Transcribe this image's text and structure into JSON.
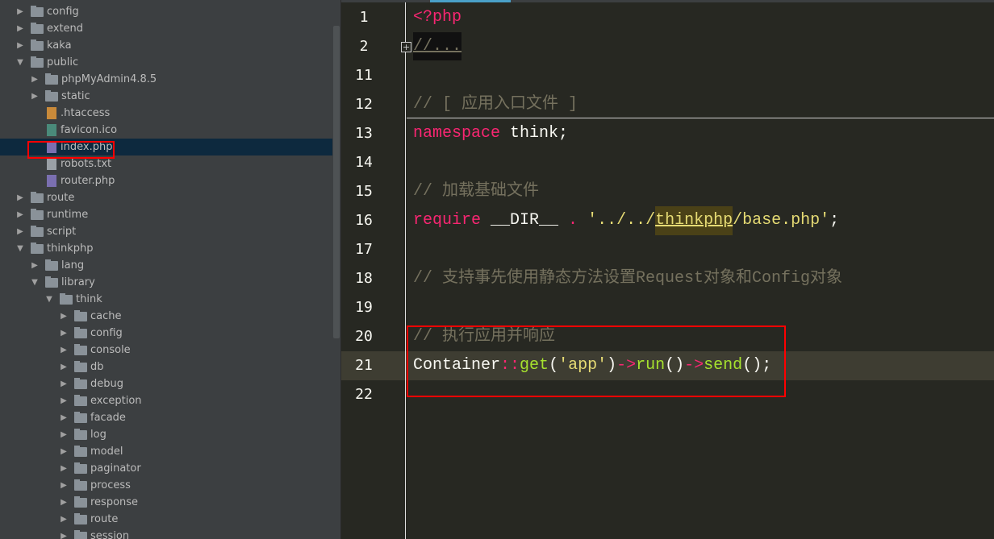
{
  "tree": [
    {
      "label": "config",
      "type": "folder",
      "level": 0,
      "expanded": false
    },
    {
      "label": "extend",
      "type": "folder",
      "level": 0,
      "expanded": false
    },
    {
      "label": "kaka",
      "type": "folder",
      "level": 0,
      "expanded": false
    },
    {
      "label": "public",
      "type": "folder",
      "level": 0,
      "expanded": true
    },
    {
      "label": "phpMyAdmin4.8.5",
      "type": "folder",
      "level": 1,
      "expanded": false
    },
    {
      "label": "static",
      "type": "folder",
      "level": 1,
      "expanded": false
    },
    {
      "label": ".htaccess",
      "type": "ht",
      "level": 1
    },
    {
      "label": "favicon.ico",
      "type": "img",
      "level": 1
    },
    {
      "label": "index.php",
      "type": "php",
      "level": 1,
      "selected": true
    },
    {
      "label": "robots.txt",
      "type": "txt",
      "level": 1
    },
    {
      "label": "router.php",
      "type": "php",
      "level": 1
    },
    {
      "label": "route",
      "type": "folder",
      "level": 0,
      "expanded": false
    },
    {
      "label": "runtime",
      "type": "folder",
      "level": 0,
      "expanded": false
    },
    {
      "label": "script",
      "type": "folder",
      "level": 0,
      "expanded": false
    },
    {
      "label": "thinkphp",
      "type": "folder",
      "level": 0,
      "expanded": true
    },
    {
      "label": "lang",
      "type": "folder",
      "level": 1,
      "expanded": false
    },
    {
      "label": "library",
      "type": "folder",
      "level": 1,
      "expanded": true
    },
    {
      "label": "think",
      "type": "folder",
      "level": 2,
      "expanded": true
    },
    {
      "label": "cache",
      "type": "folder",
      "level": 3,
      "expanded": false
    },
    {
      "label": "config",
      "type": "folder",
      "level": 3,
      "expanded": false
    },
    {
      "label": "console",
      "type": "folder",
      "level": 3,
      "expanded": false
    },
    {
      "label": "db",
      "type": "folder",
      "level": 3,
      "expanded": false
    },
    {
      "label": "debug",
      "type": "folder",
      "level": 3,
      "expanded": false
    },
    {
      "label": "exception",
      "type": "folder",
      "level": 3,
      "expanded": false
    },
    {
      "label": "facade",
      "type": "folder",
      "level": 3,
      "expanded": false
    },
    {
      "label": "log",
      "type": "folder",
      "level": 3,
      "expanded": false
    },
    {
      "label": "model",
      "type": "folder",
      "level": 3,
      "expanded": false
    },
    {
      "label": "paginator",
      "type": "folder",
      "level": 3,
      "expanded": false
    },
    {
      "label": "process",
      "type": "folder",
      "level": 3,
      "expanded": false
    },
    {
      "label": "response",
      "type": "folder",
      "level": 3,
      "expanded": false
    },
    {
      "label": "route",
      "type": "folder",
      "level": 3,
      "expanded": false
    },
    {
      "label": "session",
      "type": "folder",
      "level": 3,
      "expanded": false
    }
  ],
  "editor": {
    "fold_icon": "+",
    "lines": [
      {
        "n": "1",
        "tokens": [
          {
            "t": "<?php",
            "c": "kw"
          }
        ]
      },
      {
        "n": "2",
        "tokens": [
          {
            "t": "//...",
            "c": "cm ul"
          }
        ]
      },
      {
        "n": "11",
        "tokens": []
      },
      {
        "n": "12",
        "tokens": [
          {
            "t": "// [ 应用入口文件 ]",
            "c": "cm"
          }
        ]
      },
      {
        "n": "13",
        "tokens": [
          {
            "t": "namespace",
            "c": "kw"
          },
          {
            "t": " think;",
            "c": ""
          }
        ]
      },
      {
        "n": "14",
        "tokens": []
      },
      {
        "n": "15",
        "tokens": [
          {
            "t": "// 加载基础文件",
            "c": "cm"
          }
        ]
      },
      {
        "n": "16",
        "tokens": [
          {
            "t": "require",
            "c": "kw"
          },
          {
            "t": " __DIR__ ",
            "c": ""
          },
          {
            "t": ".",
            "c": "kw"
          },
          {
            "t": " '../../",
            "c": "str"
          },
          {
            "t": "thinkphp",
            "c": "str ul"
          },
          {
            "t": "/base.php'",
            "c": "str"
          },
          {
            "t": ";",
            "c": ""
          }
        ]
      },
      {
        "n": "17",
        "tokens": []
      },
      {
        "n": "18",
        "tokens": [
          {
            "t": "// 支持事先使用静态方法设置Request对象和Config对象",
            "c": "cm"
          }
        ]
      },
      {
        "n": "19",
        "tokens": []
      },
      {
        "n": "20",
        "tokens": [
          {
            "t": "// 执行应用并响应",
            "c": "cm"
          }
        ]
      },
      {
        "n": "21",
        "tokens": [
          {
            "t": "Container",
            "c": ""
          },
          {
            "t": "::",
            "c": "kw"
          },
          {
            "t": "get",
            "c": "fn"
          },
          {
            "t": "(",
            "c": ""
          },
          {
            "t": "'app'",
            "c": "str"
          },
          {
            "t": ")",
            "c": ""
          },
          {
            "t": "->",
            "c": "kw"
          },
          {
            "t": "run",
            "c": "fn"
          },
          {
            "t": "()",
            "c": ""
          },
          {
            "t": "->",
            "c": "kw"
          },
          {
            "t": "send",
            "c": "fn"
          },
          {
            "t": "();",
            "c": ""
          }
        ]
      },
      {
        "n": "22",
        "tokens": []
      }
    ]
  },
  "colors": {
    "sidebar_bg": "#3c3f41",
    "selected_row": "#0d293e",
    "editor_bg": "#272822",
    "keyword": "#f92672",
    "comment": "#75715e",
    "string": "#e6db74",
    "function": "#a6e22e",
    "annotation": "#ff0000"
  }
}
